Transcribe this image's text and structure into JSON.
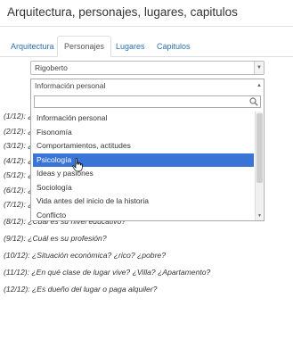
{
  "header": {
    "title": "Arquitectura, personajes, lugares, capitulos"
  },
  "tabs": [
    {
      "label": "Arquitectura",
      "active": false
    },
    {
      "label": "Personajes",
      "active": true
    },
    {
      "label": "Lugares",
      "active": false
    },
    {
      "label": "Capitulos",
      "active": false
    }
  ],
  "character_select": {
    "value": "Rigoberto"
  },
  "category_select": {
    "value": "Información personal",
    "search_placeholder": "",
    "options": [
      "Información personal",
      "Fisonomía",
      "Comportamientos, actitudes",
      "Psicología",
      "Ideas y pasiones",
      "Sociología",
      "Vida antes del inicio de la historia",
      "Conflicto"
    ],
    "highlighted_index": 3
  },
  "questions": [
    "(1/12): ¿",
    "(2/12): ¿",
    "(3/12): ¿",
    "(4/12): ¿",
    "(5/12): ¿",
    "(6/12): ¿",
    "(7/12): ¿",
    "(8/12): ¿Cuál es su nivel educativo?",
    "(9/12): ¿Cuál es su profesión?",
    "(10/12): ¿Situación económica? ¿rico? ¿pobre?",
    "(11/12): ¿En qué clase de lugar vive? ¿Villa? ¿Apartamento?",
    "(12/12): ¿Es dueño del lugar o paga alquiler?"
  ],
  "colors": {
    "accent": "#3875d7",
    "link": "#2a6fb0"
  }
}
